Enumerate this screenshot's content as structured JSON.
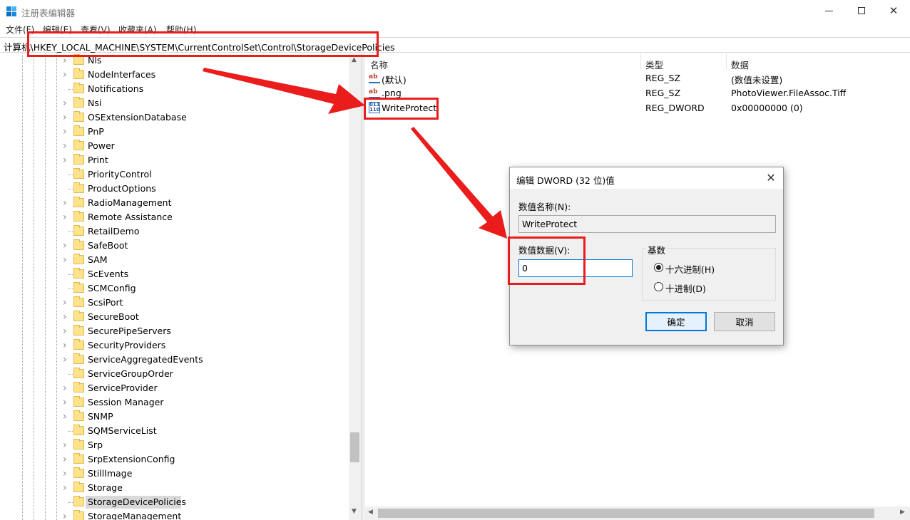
{
  "window": {
    "title": "注册表编辑器",
    "menu": [
      "文件(F)",
      "编辑(E)",
      "查看(V)",
      "收藏夹(A)",
      "帮助(H)"
    ]
  },
  "address": {
    "prefix": "计算机",
    "path": "\\HKEY_LOCAL_MACHINE\\SYSTEM\\CurrentControlSet\\Control\\StorageDevicePolicies"
  },
  "tree": {
    "items": [
      {
        "label": "Nls",
        "expandable": true
      },
      {
        "label": "NodeInterfaces",
        "expandable": true
      },
      {
        "label": "Notifications",
        "expandable": false
      },
      {
        "label": "Nsi",
        "expandable": true
      },
      {
        "label": "OSExtensionDatabase",
        "expandable": true
      },
      {
        "label": "PnP",
        "expandable": true
      },
      {
        "label": "Power",
        "expandable": true
      },
      {
        "label": "Print",
        "expandable": true
      },
      {
        "label": "PriorityControl",
        "expandable": false
      },
      {
        "label": "ProductOptions",
        "expandable": false
      },
      {
        "label": "RadioManagement",
        "expandable": true
      },
      {
        "label": "Remote Assistance",
        "expandable": true
      },
      {
        "label": "RetailDemo",
        "expandable": false
      },
      {
        "label": "SafeBoot",
        "expandable": true
      },
      {
        "label": "SAM",
        "expandable": true
      },
      {
        "label": "ScEvents",
        "expandable": false
      },
      {
        "label": "SCMConfig",
        "expandable": false
      },
      {
        "label": "ScsiPort",
        "expandable": true
      },
      {
        "label": "SecureBoot",
        "expandable": true
      },
      {
        "label": "SecurePipeServers",
        "expandable": true
      },
      {
        "label": "SecurityProviders",
        "expandable": true
      },
      {
        "label": "ServiceAggregatedEvents",
        "expandable": true
      },
      {
        "label": "ServiceGroupOrder",
        "expandable": false
      },
      {
        "label": "ServiceProvider",
        "expandable": true
      },
      {
        "label": "Session Manager",
        "expandable": true
      },
      {
        "label": "SNMP",
        "expandable": true
      },
      {
        "label": "SQMServiceList",
        "expandable": false
      },
      {
        "label": "Srp",
        "expandable": true
      },
      {
        "label": "SrpExtensionConfig",
        "expandable": true
      },
      {
        "label": "StillImage",
        "expandable": true
      },
      {
        "label": "Storage",
        "expandable": true
      },
      {
        "label": "StorageDevicePolicies",
        "expandable": false,
        "selected": true
      },
      {
        "label": "StorageManagement",
        "expandable": true
      }
    ]
  },
  "list": {
    "columns": [
      "名称",
      "类型",
      "数据"
    ],
    "rows": [
      {
        "icon": "string-value-icon",
        "name": "(默认)",
        "type": "REG_SZ",
        "data": "(数值未设置)"
      },
      {
        "icon": "string-value-icon",
        "name": ".png",
        "type": "REG_SZ",
        "data": "PhotoViewer.FileAssoc.Tiff"
      },
      {
        "icon": "dword-value-icon",
        "name": "WriteProtect",
        "type": "REG_DWORD",
        "data": "0x00000000 (0)"
      }
    ]
  },
  "dialog": {
    "title": "编辑 DWORD (32 位)值",
    "name_label": "数值名称(N):",
    "name_value": "WriteProtect",
    "data_label": "数值数据(V):",
    "data_value": "0",
    "radix_label": "基数",
    "radix_hex": "十六进制(H)",
    "radix_dec": "十进制(D)",
    "radix_selected": "hex",
    "ok": "确定",
    "cancel": "取消"
  },
  "annotation": {
    "color": "#ea1c1c"
  }
}
